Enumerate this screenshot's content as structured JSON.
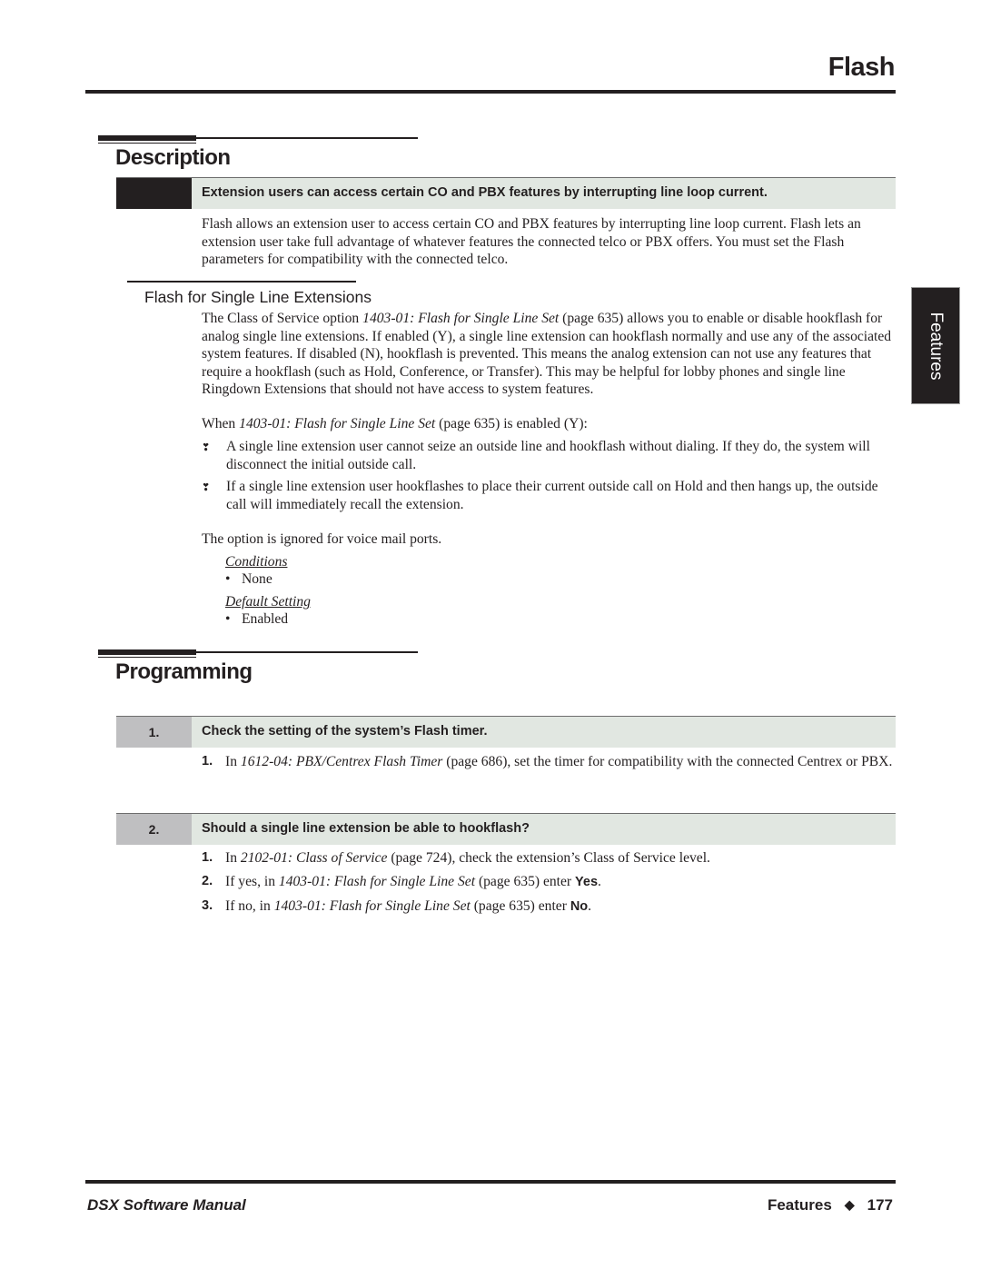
{
  "header": {
    "title": "Flash"
  },
  "side_tab": {
    "label": "Features"
  },
  "description": {
    "heading": "Description",
    "banner": "Extension users can access certain CO and PBX features by interrupting line loop current.",
    "intro": "Flash allows an extension user to access certain CO and PBX features by interrupting line loop current. Flash lets an extension user take full advantage of whatever features the connected telco or PBX offers. You must set the Flash parameters for compatibility with the connected telco.",
    "subsection": {
      "heading": "Flash for Single Line Extensions",
      "para1": {
        "before": "The Class of Service option ",
        "ref": "1403-01: Flash for Single Line Set",
        "after": " (page 635) allows you to enable or disable hookflash for analog single line extensions. If enabled (Y), a single line extension can hookflash normally and use any of the associated system features. If disabled (N), hookflash is prevented. This means the analog extension can not use any features that require a hookflash (such as Hold, Conference, or Transfer). This may be helpful for lobby phones and single line Ringdown Extensions that should not have access to system features."
      },
      "para2": {
        "before": "When ",
        "ref": "1403-01: Flash for Single Line Set",
        "after": " (page 635) is enabled (Y):"
      },
      "bullets": [
        "A single line extension user cannot seize an outside line and hookflash without dialing. If they do, the system will disconnect the initial outside call.",
        "If a single line extension user hookflashes to place their current outside call on Hold and then hangs up, the outside call will immediately recall the extension."
      ],
      "bullet_glyph": "❣",
      "para3": "The option is ignored for voice mail ports.",
      "conditions": {
        "label": "Conditions",
        "items": [
          "None"
        ]
      },
      "default_setting": {
        "label": "Default Setting",
        "items": [
          "Enabled"
        ]
      }
    }
  },
  "programming": {
    "heading": "Programming",
    "steps": [
      {
        "number": "1.",
        "title": "Check the setting of the system’s Flash timer.",
        "substeps": [
          {
            "number": "1.",
            "before": "In ",
            "ref": "1612-04: PBX/Centrex Flash Timer",
            "after": " (page 686), set the timer for compatibility with the connected Centrex or PBX.",
            "value": ""
          }
        ]
      },
      {
        "number": "2.",
        "title": "Should a single line extension be able to hookflash?",
        "substeps": [
          {
            "number": "1.",
            "before": "In ",
            "ref": "2102-01: Class of Service",
            "after": " (page 724), check the extension’s Class of Service level.",
            "value": ""
          },
          {
            "number": "2.",
            "before": "If yes, in ",
            "ref": "1403-01: Flash for Single Line Set",
            "after": " (page 635) enter ",
            "value": "Yes"
          },
          {
            "number": "3.",
            "before": "If no, in ",
            "ref": "1403-01: Flash for Single Line Set",
            "after": " (page 635) enter ",
            "value": "No"
          }
        ]
      }
    ]
  },
  "footer": {
    "manual_title": "DSX Software Manual",
    "section": "Features",
    "separator_icon": "◆",
    "page_number": "177"
  }
}
